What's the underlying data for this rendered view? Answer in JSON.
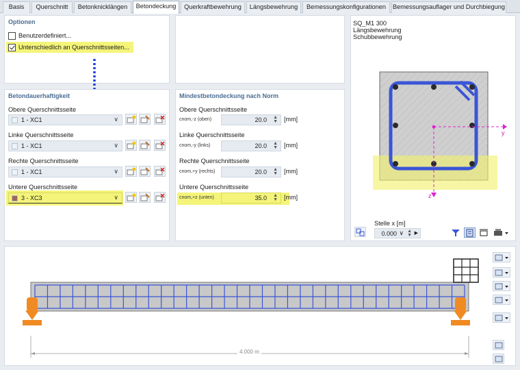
{
  "tabs": [
    "Basis",
    "Querschnitt",
    "Betonknicklängen",
    "Betondeckung",
    "Querkraftbewehrung",
    "Längsbewehrung",
    "Bemessungskonfigurationen",
    "Bemessungsauflager und Durchbiegung"
  ],
  "active_tab": "Betondeckung",
  "options": {
    "title": "Optionen",
    "user_defined": {
      "label": "Benutzerdefiniert...",
      "checked": false
    },
    "different_sides": {
      "label": "Unterschiedlich an Querschnittsseiten...",
      "checked": true
    }
  },
  "durability": {
    "title": "Betondauerhaftigkeit",
    "rows": [
      {
        "label": "Obere Querschnittsseite",
        "value": "1 - XC1",
        "swatch": "#e9f4fb"
      },
      {
        "label": "Linke Querschnittsseite",
        "value": "1 - XC1",
        "swatch": "#e9f4fb"
      },
      {
        "label": "Rechte Querschnittsseite",
        "value": "1 - XC1",
        "swatch": "#e9f4fb"
      },
      {
        "label": "Untere Querschnittsseite",
        "value": "3 - XC3",
        "swatch": "#a0665a"
      }
    ]
  },
  "min_cover": {
    "title": "Mindestbetondeckung nach Norm",
    "rows": [
      {
        "label": "Obere Querschnittsseite",
        "symbol": "cnom,-z (oben)",
        "value": "20.0",
        "unit": "[mm]"
      },
      {
        "label": "Linke Querschnittsseite",
        "symbol": "cnom,-y (links)",
        "value": "20.0",
        "unit": "[mm]"
      },
      {
        "label": "Rechte Querschnittsseite",
        "symbol": "cnom,+y (rechts)",
        "value": "20.0",
        "unit": "[mm]"
      },
      {
        "label": "Untere Querschnittsseite",
        "symbol": "cnom,+z (unten)",
        "value": "35.0",
        "unit": "[mm]"
      }
    ]
  },
  "section": {
    "name": "SQ_M1 300",
    "line2": "Längsbewehrung",
    "line3": "Schubbewehrung",
    "axis_y": "y",
    "axis_z": "z",
    "stelle_label": "Stelle x [m]",
    "stelle_value": "0.000"
  },
  "beam": {
    "length_label": "4.000 m"
  },
  "colors": {
    "highlight": "#f4f47a",
    "rebar": "#3a55d6",
    "support": "#f08a22",
    "axis": "#e020d0"
  }
}
